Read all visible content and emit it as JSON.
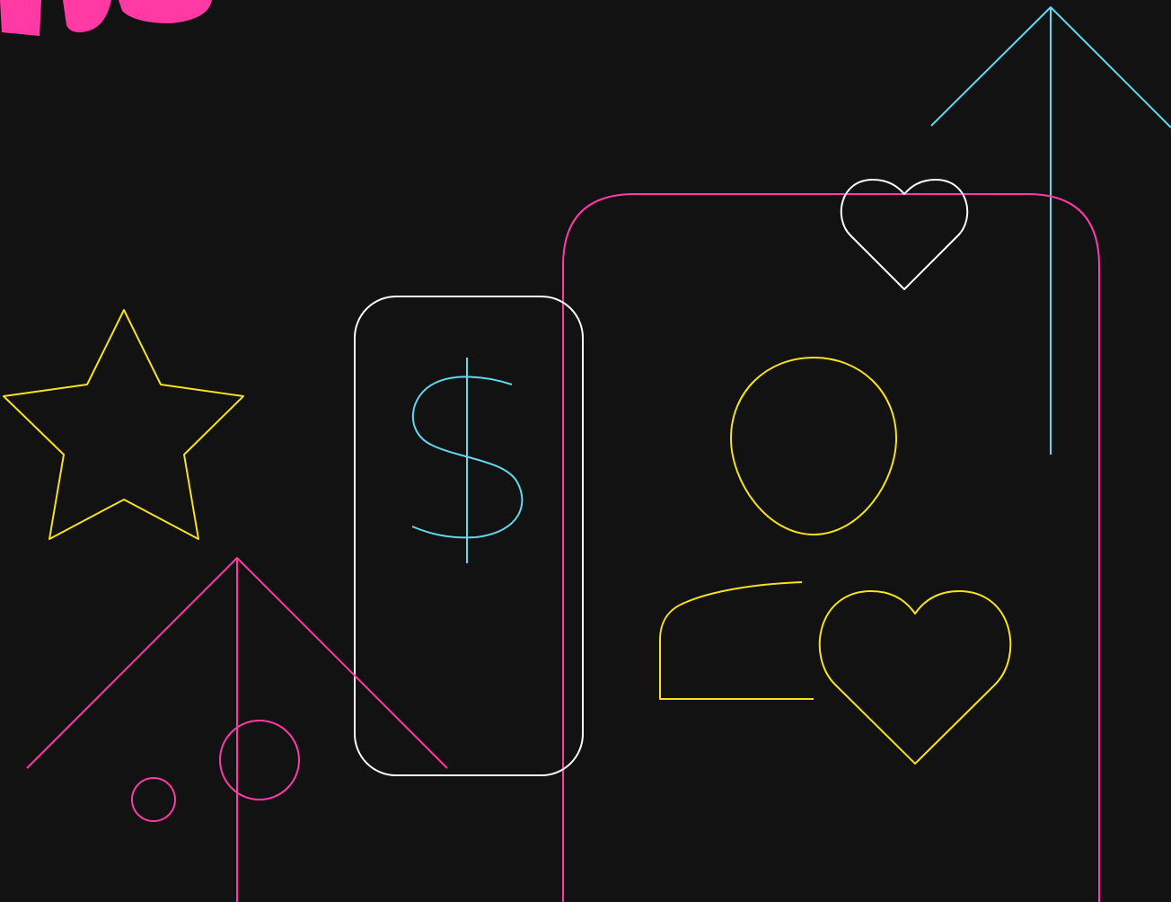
{
  "palette": {
    "background": "#121212",
    "pink": "#ff3aa5",
    "cyan": "#5fd8f0",
    "yellow": "#f7e11c",
    "white": "#ffffff"
  },
  "icons": [
    "partial-headline-glyphs",
    "up-arrow-icon",
    "small-heart-icon",
    "star-icon",
    "dollar-card-icon",
    "dollar-sign-icon",
    "phone-frame-icon",
    "user-head-icon",
    "user-body-icon",
    "large-heart-icon",
    "house-roof-icon",
    "large-circle-icon",
    "small-circle-icon"
  ]
}
